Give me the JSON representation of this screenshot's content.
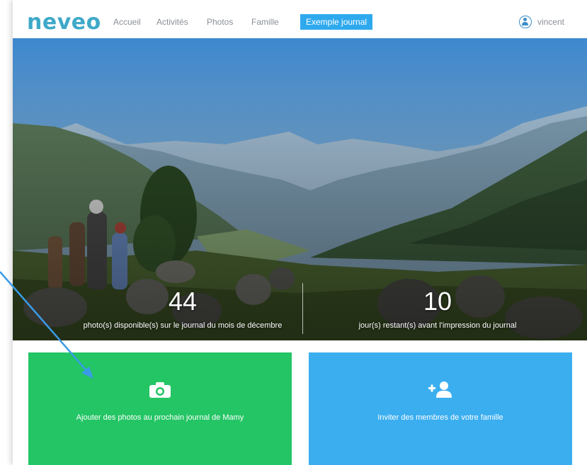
{
  "header": {
    "logo": "neveo",
    "nav": [
      "Accueil",
      "Activités",
      "Photos",
      "Famille",
      "Exemple journal"
    ],
    "active_index": 4,
    "user_name": "vincent"
  },
  "hero": {
    "stat_left": {
      "number": "44",
      "label": "photo(s) disponible(s) sur le journal du mois de décembre"
    },
    "stat_right": {
      "number": "10",
      "label": "jour(s) restant(s) avant l'impression du journal"
    }
  },
  "cards": {
    "add_photos": {
      "label": "Ajouter des photos au prochain journal de Mamy",
      "icon": "camera-icon",
      "color": "#24c564"
    },
    "invite": {
      "label": "Inviter des membres de votre famille",
      "icon": "add-user-icon",
      "color": "#3baef0"
    }
  },
  "colors": {
    "accent": "#2fa9ee",
    "logo": "#3fa9c8",
    "annotation": "#3a9be6"
  }
}
